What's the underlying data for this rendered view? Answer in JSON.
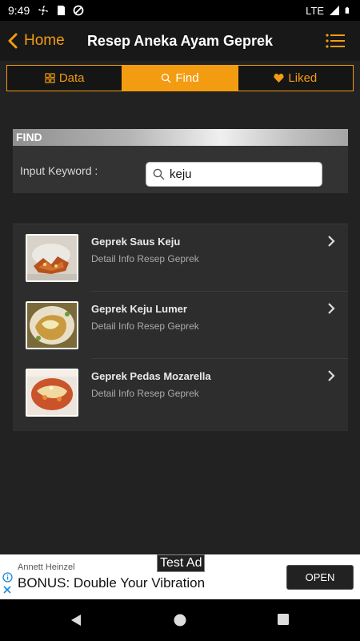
{
  "status_bar": {
    "time": "9:49",
    "network": "LTE"
  },
  "app_bar": {
    "back_label": "Home",
    "title": "Resep Aneka Ayam Geprek"
  },
  "tabs": [
    {
      "label": "Data",
      "icon": "grid-icon",
      "active": false
    },
    {
      "label": "Find",
      "icon": "search-icon",
      "active": true
    },
    {
      "label": "Liked",
      "icon": "heart-icon",
      "active": false
    }
  ],
  "find": {
    "header": "FIND",
    "keyword_label": "Input Keyword :",
    "keyword_value": "keju"
  },
  "results": [
    {
      "name": "Geprek Saus Keju",
      "subtitle": "Detail Info Resep Geprek"
    },
    {
      "name": "Geprek Keju Lumer",
      "subtitle": "Detail Info Resep Geprek"
    },
    {
      "name": "Geprek Pedas Mozarella",
      "subtitle": "Detail Info Resep Geprek"
    }
  ],
  "ad": {
    "tag": "Test Ad",
    "advertiser": "Annett Heinzel",
    "headline": "BONUS: Double Your Vibration",
    "cta": "OPEN"
  },
  "colors": {
    "accent": "#f39c12",
    "background": "#222222",
    "card": "#2d2d2d"
  }
}
